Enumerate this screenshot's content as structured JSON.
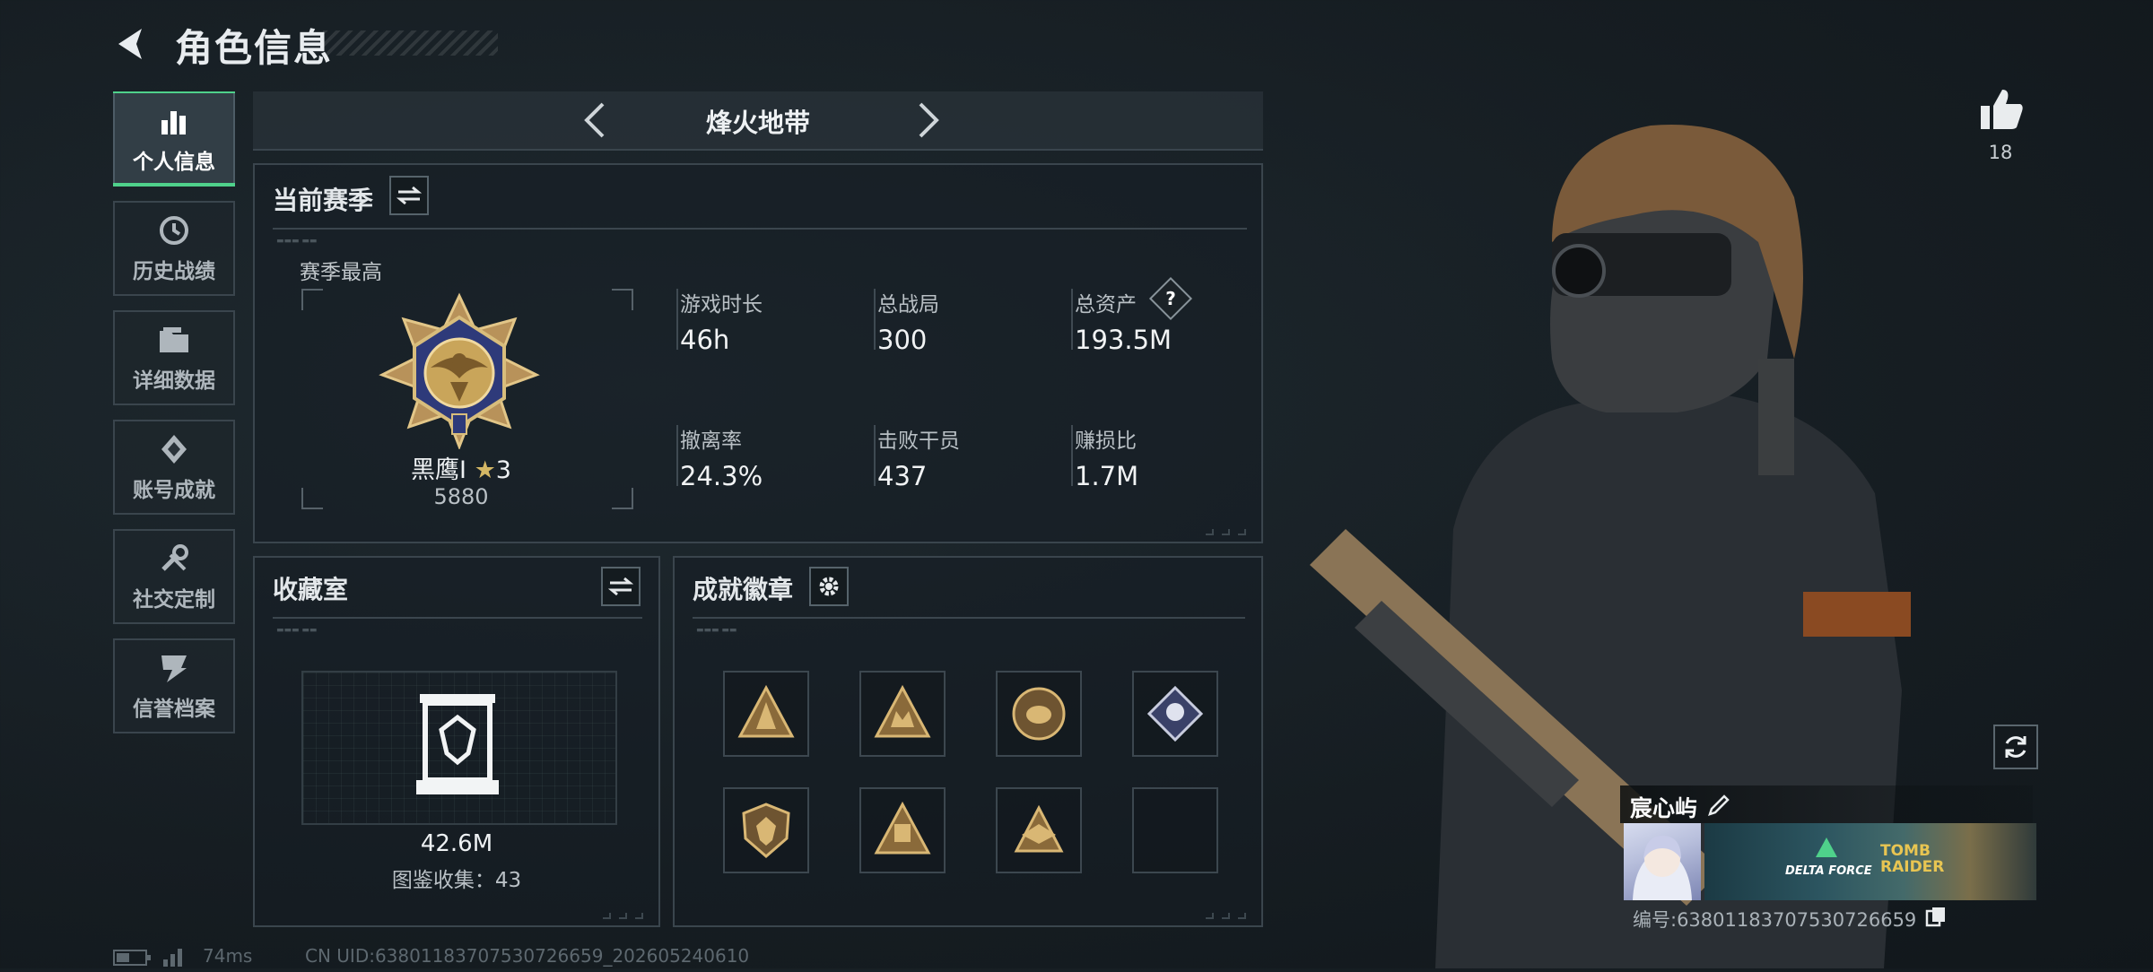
{
  "header": {
    "title": "角色信息"
  },
  "sidebar": {
    "items": [
      {
        "label": "个人信息",
        "icon": "bar-chart-icon",
        "active": true
      },
      {
        "label": "历史战绩",
        "icon": "history-icon",
        "active": false
      },
      {
        "label": "详细数据",
        "icon": "folder-icon",
        "active": false
      },
      {
        "label": "账号成就",
        "icon": "achievement-icon",
        "active": false
      },
      {
        "label": "社交定制",
        "icon": "wrench-icon",
        "active": false
      },
      {
        "label": "信誉档案",
        "icon": "credit-icon",
        "active": false
      }
    ]
  },
  "mode": {
    "title": "烽火地带"
  },
  "season": {
    "title": "当前赛季",
    "best_label": "赛季最高",
    "rank_name": "黑鹰I",
    "rank_stars": "3",
    "rank_score": "5880",
    "stats": [
      {
        "label": "游戏时长",
        "value": "46h"
      },
      {
        "label": "总战局",
        "value": "300"
      },
      {
        "label": "总资产",
        "value": "193.5M"
      },
      {
        "label": "撤离率",
        "value": "24.3%"
      },
      {
        "label": "击败干员",
        "value": "437"
      },
      {
        "label": "赚损比",
        "value": "1.7M"
      }
    ],
    "help_glyph": "?"
  },
  "collection": {
    "title": "收藏室",
    "value": "42.6M",
    "count_text": "图鉴收集：43"
  },
  "achievements": {
    "title": "成就徽章"
  },
  "social": {
    "like_count": "18"
  },
  "player": {
    "name": "宸心屿",
    "id_text": "编号:638011837075307266​59",
    "banner_text_1": "DELTA FORCE",
    "banner_text_2": "TOMB RAIDER"
  },
  "status": {
    "ping": "74ms",
    "uid_text": "CN UID:638011837075307266​59_202605240610"
  },
  "colors": {
    "accent": "#4fd18b",
    "gold": "#c9a55a"
  }
}
